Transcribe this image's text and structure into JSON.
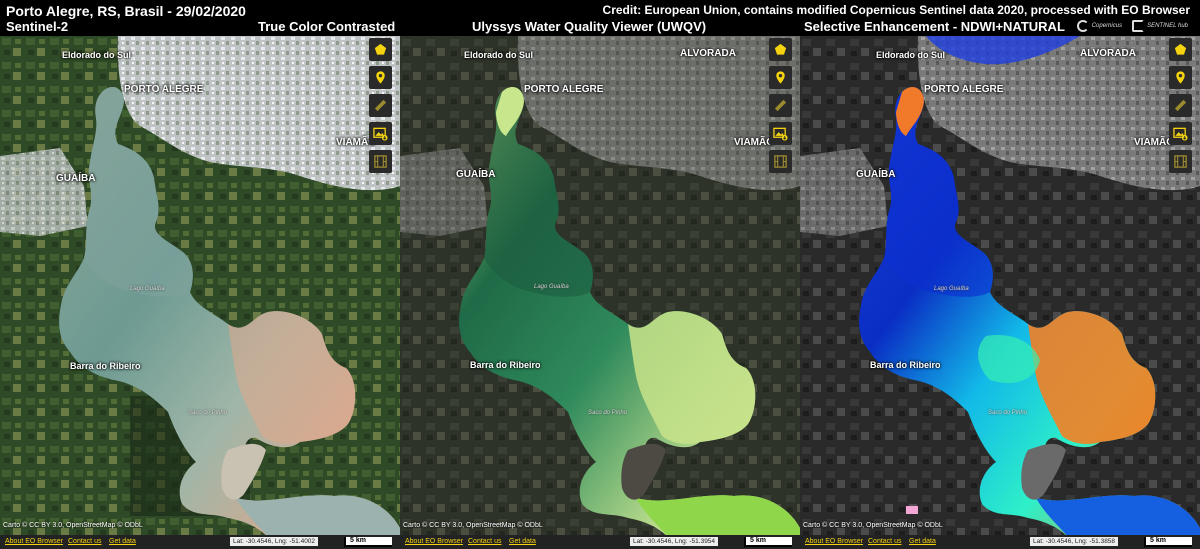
{
  "header": {
    "title": "Porto Alegre, RS, Brasil - 29/02/2020",
    "subtitle": "Sentinel-2",
    "credit": "Credit: European Union, contains modified Copernicus Sentinel data 2020, processed with EO Browser",
    "logos": [
      "Copernicus",
      "SENTINEL hub"
    ]
  },
  "panels": [
    {
      "title": "True Color Contrasted",
      "coords": "Lat: -30.4546, Lng: -51.4002",
      "scale": "5 km"
    },
    {
      "title": "Ulyssys Water Quality Viewer (UWQV)",
      "coords": "Lat: -30.4546, Lng: -51.3954",
      "scale": "5 km"
    },
    {
      "title": "Selective Enhancement - NDWI+NATURAL",
      "coords": "Lat: -30.4546, Lng: -51.3858",
      "scale": "5 km"
    }
  ],
  "map": {
    "cities": {
      "eldorado": "Eldorado do Sul",
      "porto_alegre": "PORTO ALEGRE",
      "alvorada": "ALVORADA",
      "viamao": "VIAMÃO",
      "guaiba": "GUAÍBA",
      "barra": "Barra do Ribeiro"
    },
    "water": {
      "lago": "Lago Guaíba",
      "saco": "Saco do Pinho"
    },
    "attribution": "Carto © CC BY 3.0, OpenStreetMap © ODbL",
    "links": [
      "About EO Browser",
      "Contact us",
      "Get data"
    ]
  },
  "toolbar_icons": [
    "pentagon-icon",
    "pin-icon",
    "ruler-icon",
    "image-download-icon",
    "film-icon"
  ],
  "colors": {
    "accent_yellow": "#f5d40f",
    "toolbar_bg": "#2a2a2a"
  }
}
